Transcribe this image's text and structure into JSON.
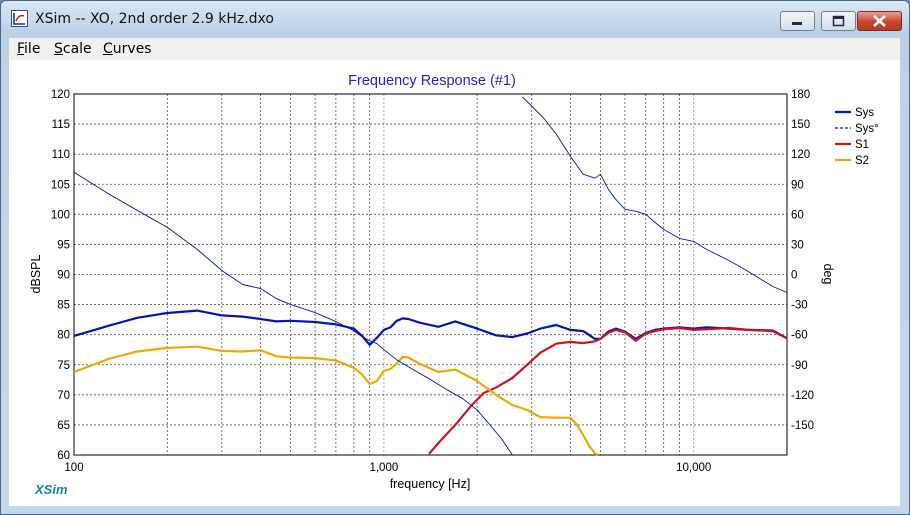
{
  "window": {
    "title": "XSim -- XO, 2nd order 2.9 kHz.dxo",
    "icon": "xsim-app-icon"
  },
  "menu": [
    {
      "u": "F",
      "rest": "ile"
    },
    {
      "u": "S",
      "rest": "cale"
    },
    {
      "u": "C",
      "rest": "urves"
    }
  ],
  "chart_data": {
    "type": "line",
    "title": "Frequency Response (#1)",
    "xlabel": "frequency [Hz]",
    "ylabel": "dBSPL",
    "y2label": "deg",
    "xscale": "log",
    "xlim": [
      100,
      20000
    ],
    "ylim": [
      60,
      120
    ],
    "y2lim": [
      -180,
      180
    ],
    "xticks": [
      {
        "v": 100,
        "label": "100"
      },
      {
        "v": 1000,
        "label": "1,000"
      },
      {
        "v": 10000,
        "label": "10,000"
      }
    ],
    "yticks": [
      120,
      115,
      110,
      105,
      100,
      95,
      90,
      85,
      80,
      75,
      70,
      65,
      60
    ],
    "y2ticks": [
      180,
      150,
      120,
      90,
      60,
      30,
      0,
      -30,
      -60,
      -90,
      -120,
      -150
    ],
    "grid": true,
    "legend_position": "right",
    "series": [
      {
        "name": "Sys",
        "color": "#0018b8",
        "axis": "left",
        "width": 2.2,
        "x": [
          100,
          130,
          160,
          200,
          250,
          300,
          350,
          400,
          450,
          500,
          600,
          700,
          800,
          850,
          900,
          950,
          1000,
          1050,
          1100,
          1150,
          1200,
          1300,
          1500,
          1700,
          2000,
          2300,
          2600,
          2900,
          3200,
          3600,
          4000,
          4400,
          4800,
          5000,
          5300,
          5600,
          6000,
          6500,
          7000,
          7500,
          8000,
          9000,
          10000,
          11000,
          13000,
          15000,
          18000,
          20000
        ],
        "y": [
          79.8,
          81.5,
          82.8,
          83.6,
          84.0,
          83.2,
          83.0,
          82.6,
          82.2,
          82.3,
          82.1,
          81.7,
          81.0,
          79.8,
          78.3,
          79.5,
          80.8,
          81.2,
          82.3,
          82.7,
          82.6,
          82.0,
          81.3,
          82.2,
          81.0,
          79.9,
          79.6,
          80.2,
          81.0,
          81.6,
          80.8,
          80.6,
          79.3,
          79.3,
          80.5,
          81.0,
          80.5,
          79.3,
          80.3,
          80.8,
          81.0,
          81.2,
          81.0,
          81.2,
          81.0,
          80.8,
          80.7,
          79.4
        ]
      },
      {
        "name": "Sys°",
        "color": "#0018b8",
        "axis": "right",
        "dashed": true,
        "width": 1.2,
        "x": [
          2650,
          2650
        ],
        "y": [
          180,
          -180
        ]
      },
      {
        "name": "S1",
        "color": "#d0131f",
        "axis": "left",
        "width": 2.2,
        "x": [
          1400,
          1500,
          1700,
          1900,
          2100,
          2300,
          2600,
          2900,
          3200,
          3600,
          4000,
          4400,
          4800,
          5000,
          5300,
          5600,
          6000,
          6500,
          7000,
          7500,
          8000,
          9000,
          10000,
          11000,
          13000,
          15000,
          18000,
          20000
        ],
        "y": [
          60.2,
          62.0,
          65.0,
          68.0,
          70.3,
          71.2,
          72.8,
          75.0,
          77.0,
          78.5,
          78.8,
          78.6,
          78.9,
          79.3,
          80.3,
          80.8,
          80.4,
          79.0,
          80.2,
          80.6,
          80.9,
          81.1,
          80.8,
          80.9,
          81.1,
          80.8,
          80.6,
          79.4
        ]
      },
      {
        "name": "S2",
        "color": "#f0a800",
        "axis": "left",
        "width": 2.2,
        "x": [
          100,
          130,
          160,
          200,
          250,
          300,
          350,
          400,
          450,
          500,
          600,
          700,
          800,
          850,
          900,
          950,
          1000,
          1050,
          1100,
          1150,
          1200,
          1300,
          1500,
          1700,
          2000,
          2300,
          2600,
          2900,
          3200,
          3600,
          4000,
          4200,
          4400,
          4600,
          4800,
          4900
        ],
        "y": [
          73.8,
          76.0,
          77.2,
          77.8,
          78.0,
          77.3,
          77.2,
          77.4,
          76.4,
          76.2,
          76.1,
          75.7,
          74.5,
          73.4,
          71.8,
          72.3,
          74.0,
          74.3,
          75.2,
          76.3,
          76.2,
          75.2,
          73.8,
          74.2,
          72.3,
          70.0,
          68.3,
          67.5,
          66.3,
          66.2,
          66.2,
          65.0,
          63.3,
          61.5,
          60.3,
          60.0
        ]
      },
      {
        "name": "Sys° (phase trace)",
        "legend": false,
        "color": "#0018b8",
        "axis": "right",
        "width": 0.9,
        "x": [
          100,
          130,
          160,
          200,
          250,
          300,
          350,
          400,
          450,
          500,
          600,
          700,
          800,
          850,
          900,
          950,
          1000,
          1100,
          1200,
          1400,
          1600,
          1800,
          2000,
          2200,
          2400,
          2600,
          2800,
          3000,
          3300,
          3600,
          4000,
          4400,
          4800,
          5000,
          5300,
          5600,
          6000,
          6500,
          7000,
          7500,
          8000,
          9000,
          10000,
          11000,
          13000,
          15000,
          18000,
          20000
        ],
        "y": [
          102,
          80,
          64,
          47,
          25,
          4,
          -10,
          -14,
          -24,
          -30,
          -38,
          -47,
          -56,
          -62,
          -66,
          -69,
          -75,
          -85,
          -92,
          -104,
          -115,
          -124,
          -135,
          -150,
          -164,
          -180,
          177,
          168,
          155,
          140,
          118,
          100,
          96,
          100,
          85,
          75,
          65,
          63,
          60,
          52,
          45,
          36,
          33,
          25,
          14,
          3,
          -12,
          -18
        ]
      }
    ]
  }
}
